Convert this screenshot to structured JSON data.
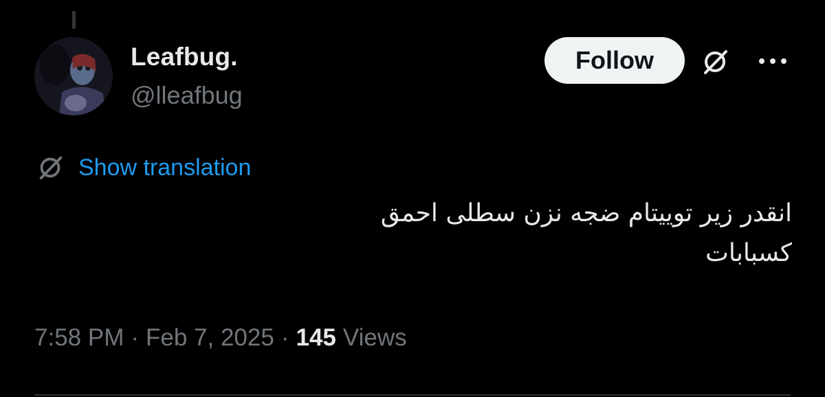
{
  "author": {
    "display_name": "Leafbug.",
    "handle": "@lleafbug"
  },
  "actions": {
    "follow_label": "Follow",
    "grok_icon": "slashed-circle-icon",
    "more_icon": "more-dots-icon"
  },
  "translation": {
    "icon": "slashed-circle-icon",
    "label": "Show translation"
  },
  "tweet": {
    "lines": [
      "انقدر زیر توییتام ضجه نزن سطلی احمق",
      "کسبابات"
    ]
  },
  "meta": {
    "time": "7:58 PM",
    "separator": "·",
    "date": "Feb 7, 2025",
    "views_count": "145",
    "views_label": "Views"
  },
  "colors": {
    "background": "#000000",
    "text_primary": "#e7e9ea",
    "text_secondary": "#71767b",
    "link": "#1d9bf0",
    "follow_bg": "#eff3f4"
  }
}
